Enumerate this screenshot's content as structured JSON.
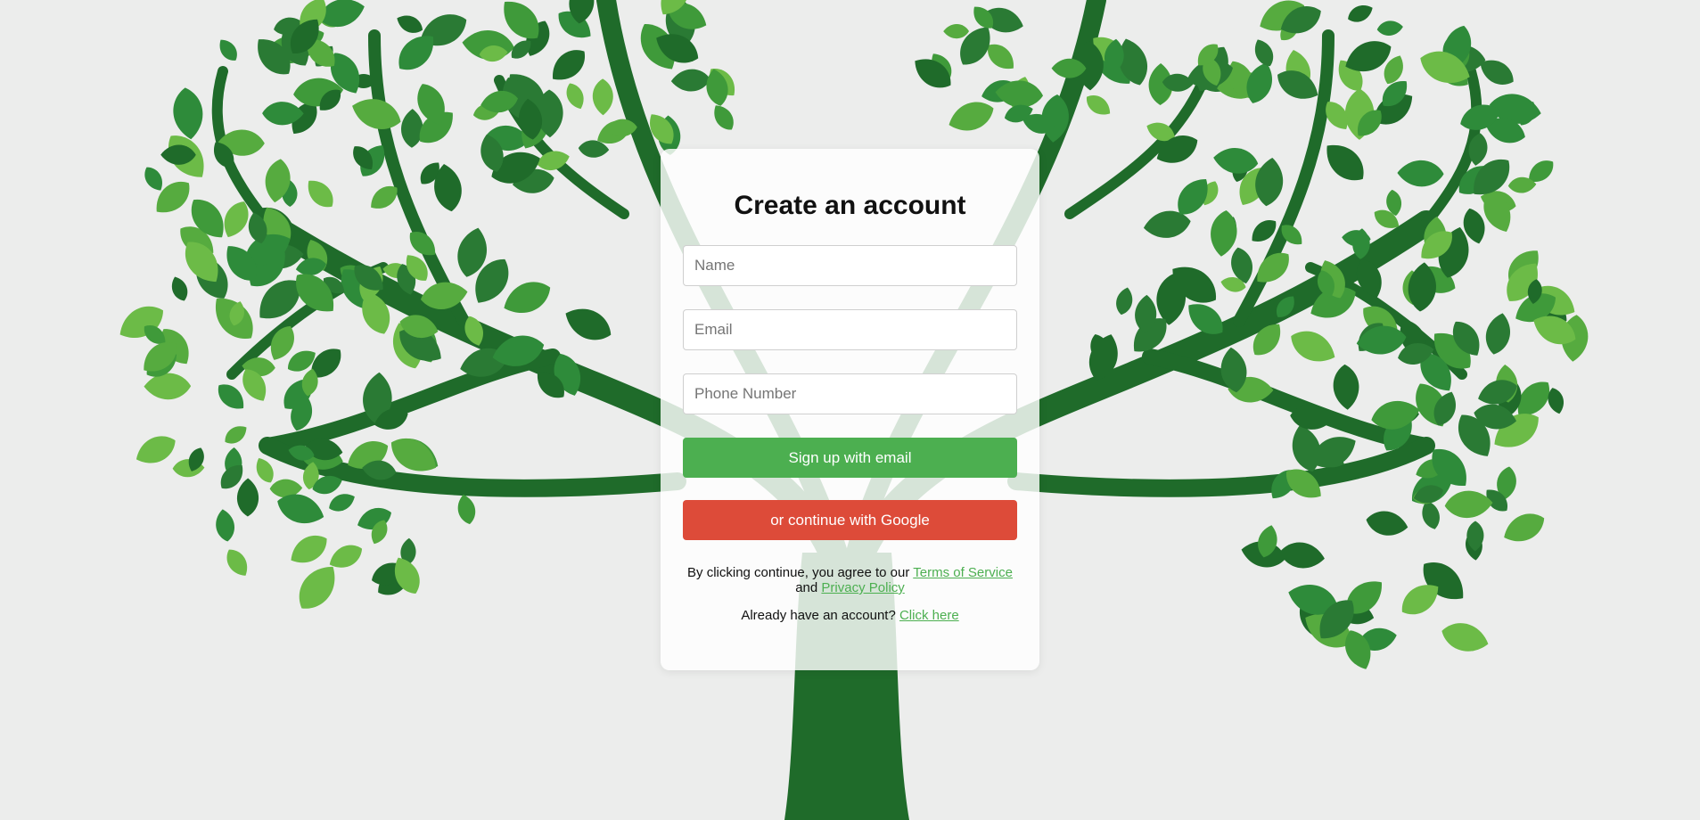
{
  "page": {
    "title": "Create an account"
  },
  "form": {
    "name_placeholder": "Name",
    "email_placeholder": "Email",
    "phone_placeholder": "Phone Number",
    "email_button": "Sign up with email",
    "google_button": "or continue with Google"
  },
  "legal": {
    "prefix": "By clicking continue, you agree to our ",
    "terms_link": "Terms of Service",
    "conjunction": " and ",
    "privacy_link": "Privacy Policy"
  },
  "login": {
    "prompt": "Already have an account? ",
    "link": "Click here"
  },
  "background": {
    "image": "green-tree-illustration",
    "leaf_color": "#3f9a3a",
    "trunk_color": "#1f6b2a"
  },
  "colors": {
    "accent": "#4caf50",
    "google": "#dd4b39"
  }
}
